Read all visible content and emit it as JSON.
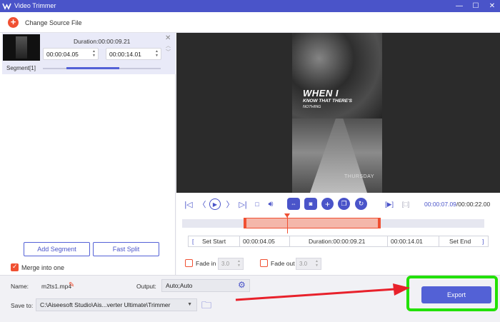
{
  "window": {
    "title": "Video Trimmer",
    "minimize_label": "—",
    "maximize_label": "☐",
    "close_label": "✕"
  },
  "topbar": {
    "change_source_label": "Change Source File"
  },
  "segment": {
    "label": "Segment[1]",
    "duration": "Duration:00:00:09.21",
    "start_time": "00:00:04.05",
    "end_time": "00:00:14.01",
    "slider_fill_fraction": 0.45
  },
  "left_actions": {
    "add_segment": "Add Segment",
    "fast_split": "Fast Split",
    "merge_label": "Merge into one",
    "merge_checked": true
  },
  "video": {
    "overlay_line1": "WHEN I",
    "overlay_line2": "KNOW THAT THERE'S",
    "overlay_line3": "NOTHING",
    "watermark": "THURSDAY"
  },
  "player": {
    "current_time": "00:00:07.09",
    "total_time": "/00:00:22.00"
  },
  "setbar": {
    "set_start": "Set Start",
    "start_value": "00:00:04.05",
    "duration": "Duration:00:00:09.21",
    "end_value": "00:00:14.01",
    "set_end": "Set End"
  },
  "fade": {
    "fade_in_label": "Fade in",
    "fade_in_value": "3.0",
    "fade_out_label": "Fade out",
    "fade_out_value": "3.0"
  },
  "bottom": {
    "name_label": "Name:",
    "name_value": "m2ts1.mp4",
    "output_label": "Output:",
    "output_value": "Auto;Auto",
    "save_label": "Save to:",
    "save_value": "C:\\Aiseesoft Studio\\Ais...verter Ultimate\\Trimmer",
    "export_label": "Export"
  },
  "colors": {
    "accent": "#4a54c9",
    "orange": "#f05032",
    "highlight_green": "#22e100",
    "arrow_red": "#e8212b"
  }
}
